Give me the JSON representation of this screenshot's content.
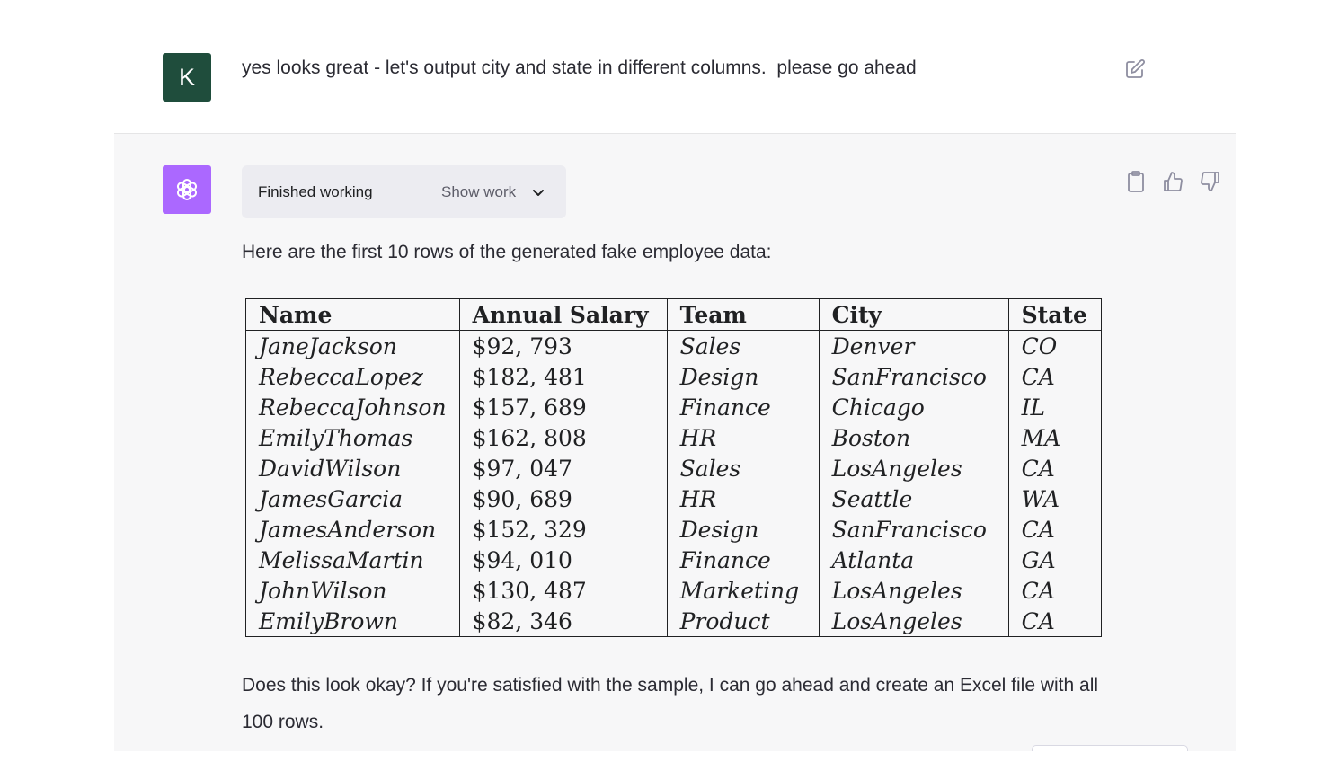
{
  "user_message": {
    "avatar_initial": "K",
    "text": "yes looks great - let's output city and state in different columns.  please go ahead"
  },
  "assistant_message": {
    "status": "Finished working",
    "show_work_label": "Show work",
    "intro": "Here are the first 10 rows of the generated fake employee data:",
    "table": {
      "headers": [
        "Name",
        "Annual Salary",
        "Team",
        "City",
        "State"
      ],
      "rows": [
        [
          "JaneJackson",
          "$92, 793",
          "Sales",
          "Denver",
          "CO"
        ],
        [
          "RebeccaLopez",
          "$182, 481",
          "Design",
          "SanFrancisco",
          "CA"
        ],
        [
          "RebeccaJohnson",
          "$157, 689",
          "Finance",
          "Chicago",
          "IL"
        ],
        [
          "EmilyThomas",
          "$162, 808",
          "HR",
          "Boston",
          "MA"
        ],
        [
          "DavidWilson",
          "$97, 047",
          "Sales",
          "LosAngeles",
          "CA"
        ],
        [
          "JamesGarcia",
          "$90, 689",
          "HR",
          "Seattle",
          "WA"
        ],
        [
          "JamesAnderson",
          "$152, 329",
          "Design",
          "SanFrancisco",
          "CA"
        ],
        [
          "MelissaMartin",
          "$94, 010",
          "Finance",
          "Atlanta",
          "GA"
        ],
        [
          "JohnWilson",
          "$130, 487",
          "Marketing",
          "LosAngeles",
          "CA"
        ],
        [
          "EmilyBrown",
          "$82, 346",
          "Product",
          "LosAngeles",
          "CA"
        ]
      ]
    },
    "outro": "Does this look okay? If you're satisfied with the sample, I can go ahead and create an Excel file with all 100 rows."
  },
  "icons": {
    "edit": "edit-icon",
    "copy": "clipboard-icon",
    "thumbs_up": "thumbs-up-icon",
    "thumbs_down": "thumbs-down-icon",
    "assistant_logo": "openai-logo-icon",
    "chevron": "chevron-down-icon"
  },
  "colors": {
    "user_avatar": "#1f4d3c",
    "assistant_avatar": "#ab68ff",
    "assistant_bg": "#f7f7f8",
    "pill_bg": "#ececf1"
  }
}
